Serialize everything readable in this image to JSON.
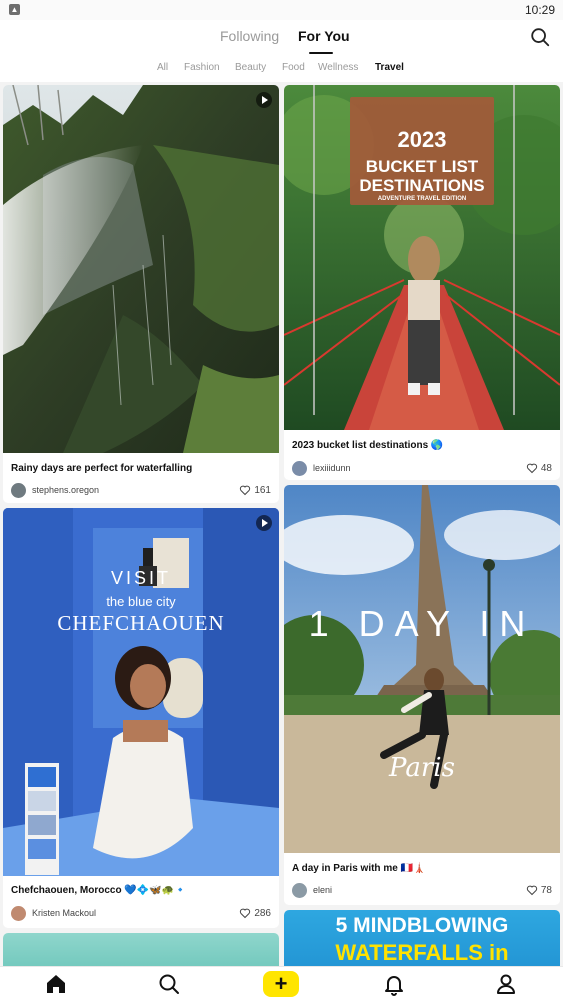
{
  "status_bar": {
    "time": "10:29"
  },
  "top_nav": {
    "tabs": [
      {
        "label": "Following",
        "active": false
      },
      {
        "label": "For You",
        "active": true
      }
    ],
    "search_icon": "search-icon"
  },
  "categories": [
    {
      "label": "All",
      "active": false
    },
    {
      "label": "Fashion",
      "active": false
    },
    {
      "label": "Beauty",
      "active": false
    },
    {
      "label": "Food",
      "active": false
    },
    {
      "label": "Wellness",
      "active": false
    },
    {
      "label": "Travel",
      "active": true
    }
  ],
  "feed": {
    "posts": [
      {
        "title": "Rainy days are perfect for waterfalling",
        "author": "stephens.oregon",
        "likes": "161",
        "is_video": true
      },
      {
        "title": "2023 bucket list destinations 🌎",
        "author": "lexiiidunn",
        "likes": "48",
        "is_video": false,
        "overlay": {
          "line1": "2023",
          "line2": "BUCKET LIST",
          "line3": "DESTINATIONS",
          "line4": "ADVENTURE TRAVEL EDITION"
        }
      },
      {
        "title": "Chefchaouen, Morocco 💙💠🦋🐢🔹",
        "author": "Kristen Mackoul",
        "likes": "286",
        "is_video": true,
        "overlay": {
          "line1": "VISIT",
          "line2": "the blue city",
          "line3": "CHEFCHAOUEN"
        }
      },
      {
        "title": "A day in Paris with me 🇫🇷🗼",
        "author": "eleni",
        "likes": "78",
        "is_video": false,
        "overlay": {
          "line1": "1 DAY IN",
          "line2": "Paris"
        }
      },
      {
        "overlay": {
          "line1": "5 MINDBLOWING",
          "line2": "WATERFALLS in"
        }
      }
    ]
  },
  "bottom_nav": {
    "items": [
      "home-icon",
      "search-icon",
      "plus-icon",
      "bell-icon",
      "profile-icon"
    ],
    "plus_label": "+"
  },
  "colors": {
    "accent_yellow": "#ffe500",
    "text": "#111111",
    "muted": "#9a9a9a"
  }
}
